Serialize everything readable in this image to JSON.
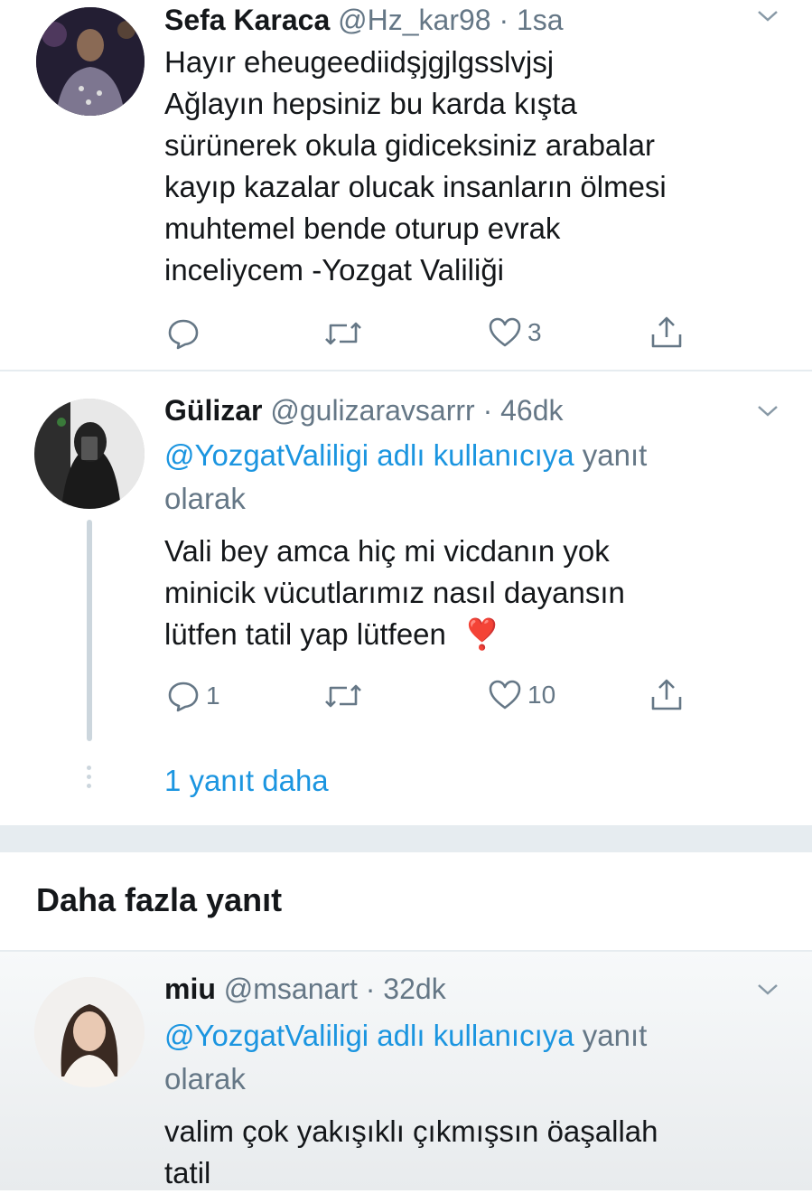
{
  "tweet1": {
    "name": "Sefa Karaca",
    "handle": "@Hz_kar98",
    "time": "· 1sa",
    "lines": [
      "Hayır eheugeediidşjgjlgsslvjsj",
      "Ağlayın hepsiniz bu karda kışta",
      "sürünerek okula gidiceksiniz arabalar",
      "kayıp kazalar olucak insanların ölmesi",
      "muhtemel bende oturup evrak",
      "inceliycem -Yozgat Valiliği"
    ],
    "like_count": "3",
    "icons": {
      "reply": "reply-icon",
      "retweet": "retweet-icon",
      "like": "heart-icon",
      "share": "share-icon",
      "menu": "chevron-down-icon"
    }
  },
  "tweet2": {
    "name": "Gülizar",
    "handle": "@gulizaravsarrr",
    "time": "· 46dk",
    "reply_mention": "@YozgatValiligi adlı kullanıcıya",
    "reply_suffix": "yanıt",
    "reply_suffix2": "olarak",
    "lines": [
      "Vali bey amca hiç mi vicdanın yok",
      "minicik vücutlarımız nasıl dayansın",
      "lütfen tatil yap lütfeen"
    ],
    "emoji": "❣️",
    "reply_count": "1",
    "like_count": "10",
    "more_replies": "1 yanıt daha"
  },
  "section": {
    "title": "Daha fazla yanıt"
  },
  "tweet3": {
    "name": "miu",
    "handle": "@msanart",
    "time": "· 32dk",
    "reply_mention": "@YozgatValiligi adlı kullanıcıya",
    "reply_suffix": "yanıt",
    "reply_suffix2": "olarak",
    "lines": [
      "valim çok yakışıklı çıkmışsın öaşallah",
      "tatil"
    ]
  },
  "colors": {
    "text": "#14171a",
    "meta": "#657786",
    "link": "#1b95e0",
    "emoji": "#e0245e"
  }
}
